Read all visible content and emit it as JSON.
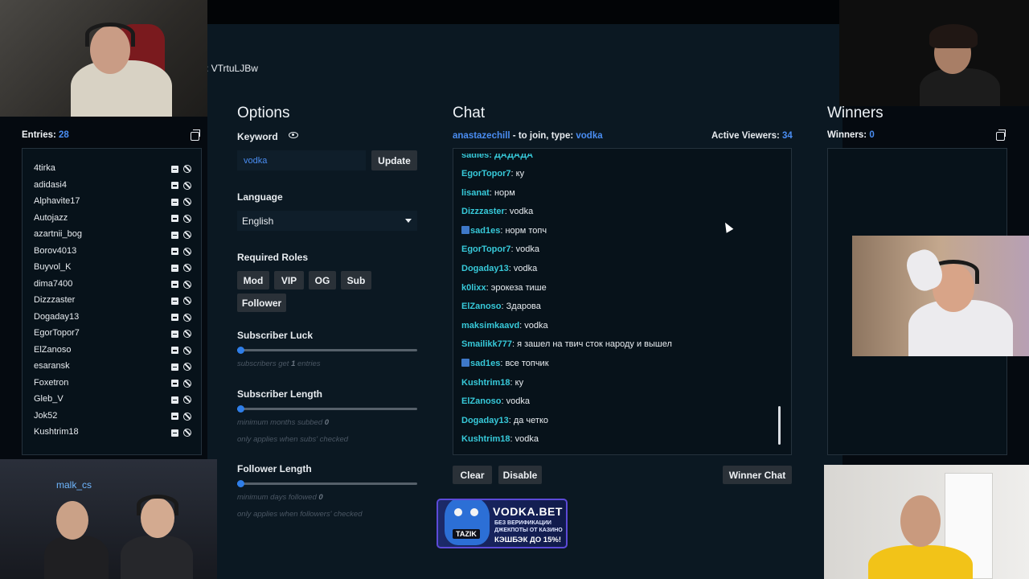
{
  "header": {
    "id_text": ": VTrtuLJBw"
  },
  "entries": {
    "title": "Entries",
    "count_label": "Entries:",
    "count": "28",
    "items": [
      "4tirka",
      "adidasi4",
      "Alphavite17",
      "Autojazz",
      "azartnii_bog",
      "Borov4013",
      "Buyvol_K",
      "dima7400",
      "Dizzzaster",
      "Dogaday13",
      "EgorTopor7",
      "ElZanoso",
      "esaransk",
      "Foxetron",
      "Gleb_V",
      "Jok52",
      "Kushtrim18"
    ]
  },
  "options": {
    "title": "Options",
    "keyword_label": "Keyword",
    "keyword_value": "vodka",
    "update_label": "Update",
    "language_label": "Language",
    "language_value": "English",
    "roles_label": "Required Roles",
    "roles": [
      "Mod",
      "VIP",
      "OG",
      "Sub",
      "Follower"
    ],
    "sub_luck_label": "Subscriber Luck",
    "sub_luck_hint_pre": "subscribers get",
    "sub_luck_value": "1",
    "sub_luck_hint_post": "entries",
    "sub_length_label": "Subscriber Length",
    "sub_length_hint": "minimum months subbed",
    "sub_length_value": "0",
    "sub_length_note": "only applies when subs' checked",
    "follow_length_label": "Follower Length",
    "follow_length_hint": "minimum days followed",
    "follow_length_value": "0",
    "follow_length_note": "only applies when followers' checked",
    "sub_luck_level": 0.02,
    "sub_length_level": 0.02,
    "follow_length_level": 0.02
  },
  "chat": {
    "title": "Chat",
    "host": "anastazechill",
    "join_text": "- to join, type:",
    "keyword": "vodka",
    "viewers_label": "Active Viewers:",
    "viewers": "34",
    "partial_top": "sadles: ДАДАДА",
    "messages": [
      {
        "user": "EgorTopor7",
        "text": "ку",
        "badge": false
      },
      {
        "user": "lisanat",
        "text": "норм",
        "badge": false
      },
      {
        "user": "Dizzzaster",
        "text": "vodka",
        "badge": false
      },
      {
        "user": "sad1es",
        "text": "норм топч",
        "badge": true
      },
      {
        "user": "EgorTopor7",
        "text": "vodka",
        "badge": false
      },
      {
        "user": "Dogaday13",
        "text": "vodka",
        "badge": false
      },
      {
        "user": "k0lixx",
        "text": "эрокеза тише",
        "badge": false
      },
      {
        "user": "ElZanoso",
        "text": "Здарова",
        "badge": false
      },
      {
        "user": "maksimkaavd",
        "text": "vodka",
        "badge": false
      },
      {
        "user": "Smailikk777",
        "text": "я зашел на твич сток народу и вышел",
        "badge": false
      },
      {
        "user": "sad1es",
        "text": "все топчик",
        "badge": true
      },
      {
        "user": "Kushtrim18",
        "text": "ку",
        "badge": false
      },
      {
        "user": "ElZanoso",
        "text": "vodka",
        "badge": false
      },
      {
        "user": "Dogaday13",
        "text": "да четко",
        "badge": false
      },
      {
        "user": "Kushtrim18",
        "text": "vodka",
        "badge": false
      }
    ],
    "clear_label": "Clear",
    "disable_label": "Disable",
    "winner_chat_label": "Winner Chat"
  },
  "winners": {
    "title": "Winners",
    "count_label": "Winners:",
    "count": "0"
  },
  "overlay": {
    "cam_label": "malk_cs",
    "promo_title": "VODKA.BET",
    "promo_tag": "TAZIK",
    "promo_line1": "БЕЗ ВЕРИФИКАЦИИ",
    "promo_line2": "ДЖЕКПОТЫ ОТ КАЗИНО",
    "promo_line3": "КЭШБЭК ДО 15%!"
  },
  "colors": {
    "accent": "#4a8df2",
    "username": "#37c9d9",
    "panel": "#07121a",
    "button": "#2a3138"
  }
}
